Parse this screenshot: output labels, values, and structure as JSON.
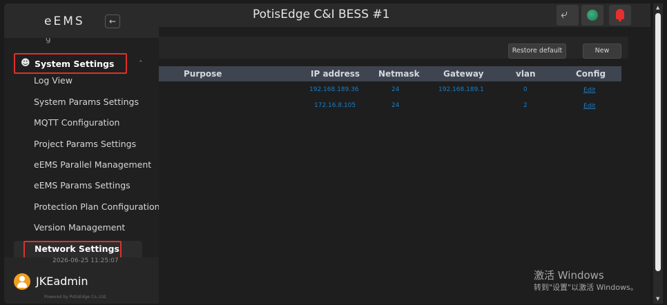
{
  "sidebar": {
    "logo": "eEMS",
    "collapse_icon": "←",
    "system_settings_label": "System Settings",
    "menu": [
      {
        "label": "Log View"
      },
      {
        "label": "System Params Settings"
      },
      {
        "label": "MQTT Configuration"
      },
      {
        "label": "Project Params Settings"
      },
      {
        "label": "eEMS Parallel Management"
      },
      {
        "label": "eEMS Params Settings"
      },
      {
        "label": "Protection Plan Configuration"
      },
      {
        "label": "Version Management"
      }
    ],
    "active_item": "Network Settings",
    "datetime": "2026-06-25 11:25:07",
    "username": "JKEadmin",
    "powered_by": "Powered by PotisEdge Co.,Ltd."
  },
  "header": {
    "title": "PotisEdge C&I BESS #1"
  },
  "toolbar": {
    "restore_label": "Restore default",
    "new_label": "New"
  },
  "table": {
    "columns": [
      "Purpose",
      "IP address",
      "Netmask",
      "Gateway",
      "vlan",
      "Config"
    ],
    "rows": [
      {
        "purpose": "",
        "ip": "192.168.189.36",
        "netmask": "24",
        "gateway": "192.168.189.1",
        "vlan": "0",
        "config": "Edit"
      },
      {
        "purpose": "",
        "ip": "172.16.8.105",
        "netmask": "24",
        "gateway": "",
        "vlan": "2",
        "config": "Edit"
      }
    ]
  },
  "watermark": {
    "line1": "激活 Windows",
    "line2": "转到\"设置\"以激活 Windows。"
  },
  "colors": {
    "accent_red": "#e0302c",
    "link_blue": "#1a7ec8",
    "table_header": "#3e4450"
  }
}
